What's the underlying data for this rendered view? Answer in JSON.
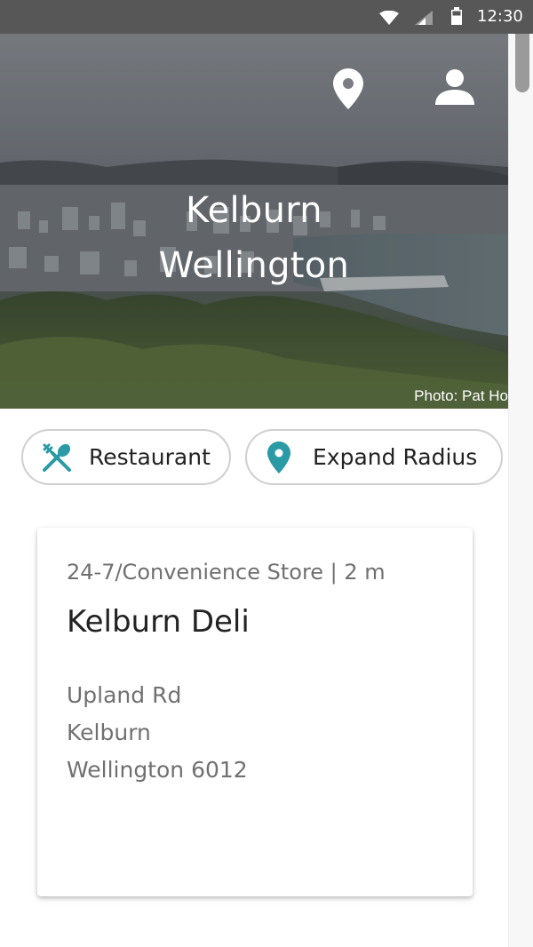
{
  "status_bar": {
    "time": "12:30",
    "icons": [
      "wifi-icon",
      "cell-signal-icon",
      "battery-icon"
    ]
  },
  "header": {
    "title_line1": "Kelburn",
    "title_line2": "Wellington",
    "photo_credit": "Photo: Pat Ho",
    "icons": [
      "location-pin-icon",
      "profile-icon"
    ]
  },
  "filters": {
    "restaurant_label": "Restaurant",
    "radius_label": "Expand Radius",
    "icons": [
      "utensils-icon",
      "location-pin-icon"
    ]
  },
  "result_card": {
    "category": "24-7/Convenience Store | 2 m",
    "name": "Kelburn Deli",
    "address_line1": "Upland Rd",
    "address_line2": "Kelburn",
    "address_line3": "Wellington 6012"
  },
  "colors": {
    "accent": "#2a9aa5",
    "status_bar": "#575757",
    "chip_border": "#cfcfcf",
    "secondary_text": "#707070"
  }
}
